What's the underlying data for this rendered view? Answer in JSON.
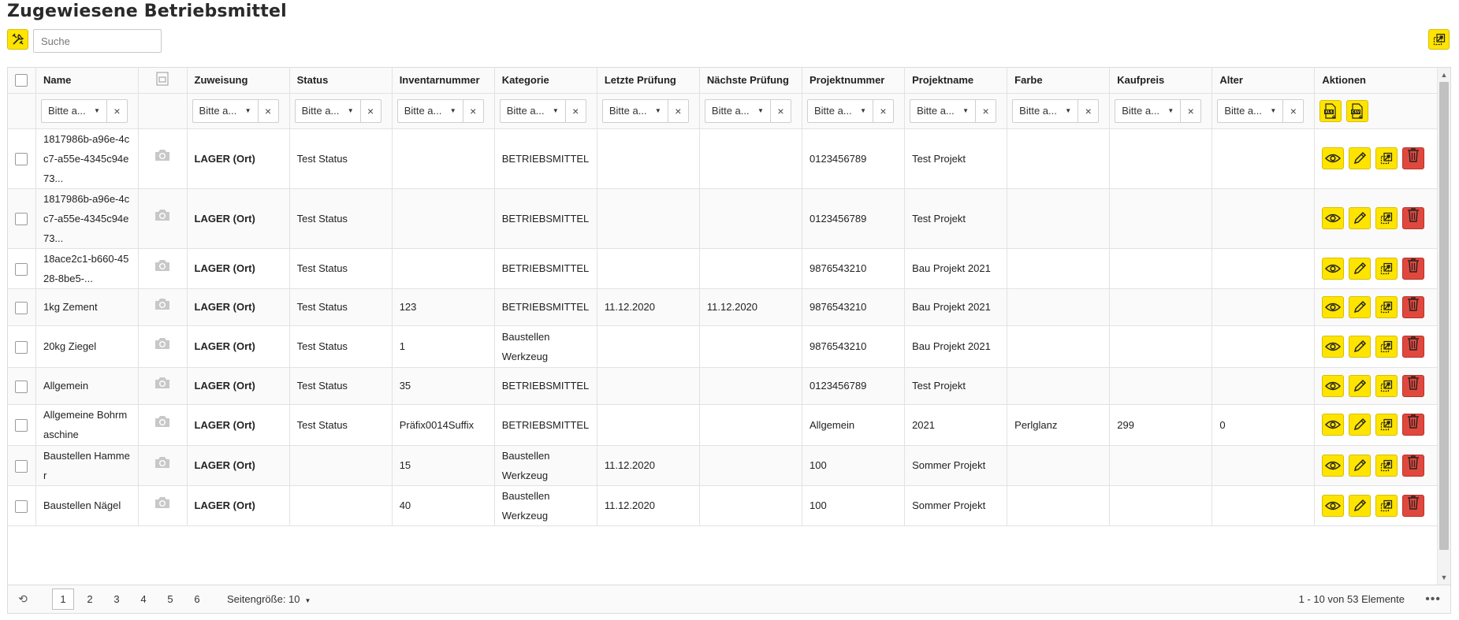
{
  "page": {
    "title": "Zugewiesene Betriebsmittel",
    "search_placeholder": "Suche"
  },
  "icons": {
    "tools": "tools-icon",
    "export": "export-icon",
    "camera": "camera-icon",
    "view": "eye-icon",
    "edit": "pencil-icon",
    "delete": "trash-icon",
    "excel": "excel-export-icon",
    "csv": "csv-export-icon",
    "refresh": "refresh-icon"
  },
  "colors": {
    "accent_yellow": "#ffe400",
    "danger_red": "#e0483e"
  },
  "columns": {
    "name": "Name",
    "zuweisung": "Zuweisung",
    "status": "Status",
    "inventarnummer": "Inventarnummer",
    "kategorie": "Kategorie",
    "letzte_pruefung": "Letzte Prüfung",
    "naechste_pruefung": "Nächste Prüfung",
    "projektnummer": "Projektnummer",
    "projektname": "Projektname",
    "farbe": "Farbe",
    "kaufpreis": "Kaufpreis",
    "alter": "Alter",
    "aktionen": "Aktionen"
  },
  "filter": {
    "placeholder": "Bitte a...",
    "clear": "×"
  },
  "rows": [
    {
      "name": "1817986b-a96e-4cc7-a55e-4345c94e73...",
      "zuweisung": "LAGER (Ort)",
      "status": "Test Status",
      "inventarnummer": "",
      "kategorie": "BETRIEBSMITTEL",
      "letzte": "",
      "naechste": "",
      "projektnummer": "0123456789",
      "projektname": "Test Projekt",
      "farbe": "",
      "kaufpreis": "",
      "alter": ""
    },
    {
      "name": "1817986b-a96e-4cc7-a55e-4345c94e73...",
      "zuweisung": "LAGER (Ort)",
      "status": "Test Status",
      "inventarnummer": "",
      "kategorie": "BETRIEBSMITTEL",
      "letzte": "",
      "naechste": "",
      "projektnummer": "0123456789",
      "projektname": "Test Projekt",
      "farbe": "",
      "kaufpreis": "",
      "alter": ""
    },
    {
      "name": "18ace2c1-b660-4528-8be5-...",
      "zuweisung": "LAGER (Ort)",
      "status": "Test Status",
      "inventarnummer": "",
      "kategorie": "BETRIEBSMITTEL",
      "letzte": "",
      "naechste": "",
      "projektnummer": "9876543210",
      "projektname": "Bau Projekt 2021",
      "farbe": "",
      "kaufpreis": "",
      "alter": ""
    },
    {
      "name": "1kg Zement",
      "zuweisung": "LAGER (Ort)",
      "status": "Test Status",
      "inventarnummer": "123",
      "kategorie": "BETRIEBSMITTEL",
      "letzte": "11.12.2020",
      "naechste": "11.12.2020",
      "projektnummer": "9876543210",
      "projektname": "Bau Projekt 2021",
      "farbe": "",
      "kaufpreis": "",
      "alter": ""
    },
    {
      "name": "20kg Ziegel",
      "zuweisung": "LAGER (Ort)",
      "status": "Test Status",
      "inventarnummer": "1",
      "kategorie": "Baustellen Werkzeug",
      "letzte": "",
      "naechste": "",
      "projektnummer": "9876543210",
      "projektname": "Bau Projekt 2021",
      "farbe": "",
      "kaufpreis": "",
      "alter": ""
    },
    {
      "name": "Allgemein",
      "zuweisung": "LAGER (Ort)",
      "status": "Test Status",
      "inventarnummer": "35",
      "kategorie": "BETRIEBSMITTEL",
      "letzte": "",
      "naechste": "",
      "projektnummer": "0123456789",
      "projektname": "Test Projekt",
      "farbe": "",
      "kaufpreis": "",
      "alter": ""
    },
    {
      "name": "Allgemeine Bohrmaschine",
      "zuweisung": "LAGER (Ort)",
      "status": "Test Status",
      "inventarnummer": "Präfix0014Suffix",
      "kategorie": "BETRIEBSMITTEL",
      "letzte": "",
      "naechste": "",
      "projektnummer": "Allgemein",
      "projektname": "2021",
      "farbe": "Perlglanz",
      "kaufpreis": "299",
      "alter": "0"
    },
    {
      "name": "Baustellen Hammer",
      "zuweisung": "LAGER (Ort)",
      "status": "",
      "inventarnummer": "15",
      "kategorie": "Baustellen Werkzeug",
      "letzte": "11.12.2020",
      "naechste": "",
      "projektnummer": "100",
      "projektname": "Sommer Projekt",
      "farbe": "",
      "kaufpreis": "",
      "alter": ""
    },
    {
      "name": "Baustellen Nägel",
      "zuweisung": "LAGER (Ort)",
      "status": "",
      "inventarnummer": "40",
      "kategorie": "Baustellen Werkzeug",
      "letzte": "11.12.2020",
      "naechste": "",
      "projektnummer": "100",
      "projektname": "Sommer Projekt",
      "farbe": "",
      "kaufpreis": "",
      "alter": ""
    }
  ],
  "pager": {
    "pages": [
      "1",
      "2",
      "3",
      "4",
      "5",
      "6"
    ],
    "active_page": "1",
    "page_size_label": "Seitengröße: 10",
    "count_text": "1 - 10 von 53 Elemente",
    "more": "•••"
  }
}
